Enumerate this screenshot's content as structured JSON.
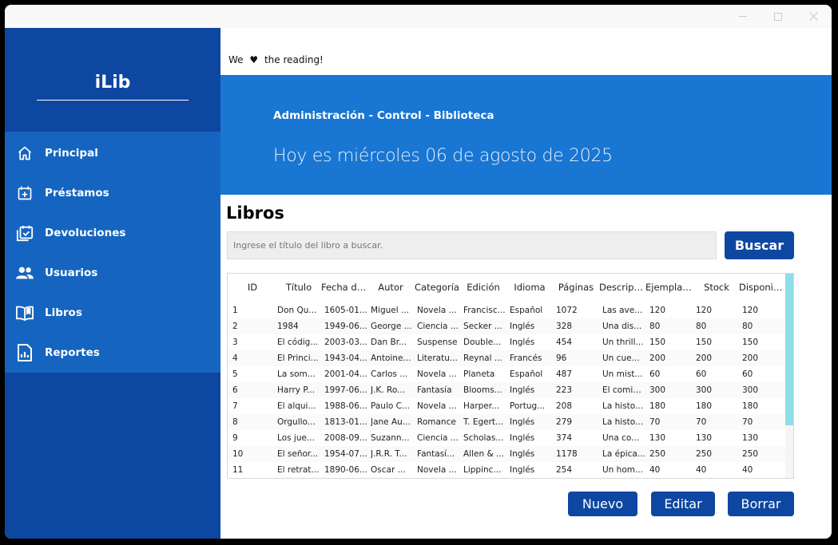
{
  "sidebar": {
    "logo": "iLib",
    "items": [
      {
        "label": "Principal",
        "icon": "home-icon"
      },
      {
        "label": "Préstamos",
        "icon": "calendar-plus-icon"
      },
      {
        "label": "Devoluciones",
        "icon": "calendar-check-icon"
      },
      {
        "label": "Usuarios",
        "icon": "users-icon"
      },
      {
        "label": "Libros",
        "icon": "book-open-icon"
      },
      {
        "label": "Reportes",
        "icon": "report-icon"
      }
    ]
  },
  "header": {
    "tagline_start": "We",
    "tagline_heart": "♥",
    "tagline_end": "the reading!",
    "subtitle": "Administración - Control - Biblioteca",
    "date_text": "Hoy es miércoles 06 de agosto de 2025"
  },
  "main": {
    "title": "Libros",
    "search_placeholder": "Ingrese el título del libro a buscar.",
    "search_button": "Buscar",
    "new_button": "Nuevo",
    "edit_button": "Editar",
    "delete_button": "Borrar"
  },
  "table": {
    "columns": [
      "ID",
      "Título",
      "Fecha de...",
      "Autor",
      "Categoría",
      "Edición",
      "Idioma",
      "Páginas",
      "Descripci...",
      "Ejemplares",
      "Stock",
      "Disponib..."
    ],
    "rows": [
      [
        "1",
        "Don Qu...",
        "1605-01...",
        "Miguel ...",
        "Novela ...",
        "Francisc...",
        "Español",
        "1072",
        "Las ave...",
        "120",
        "120",
        "120"
      ],
      [
        "2",
        "1984",
        "1949-06...",
        "George ...",
        "Ciencia ...",
        "Secker ...",
        "Inglés",
        "328",
        "Una dis...",
        "80",
        "80",
        "80"
      ],
      [
        "3",
        "El códig...",
        "2003-03...",
        "Dan Br...",
        "Suspense",
        "Double...",
        "Inglés",
        "454",
        "Un thrill...",
        "150",
        "150",
        "150"
      ],
      [
        "4",
        "El Princi...",
        "1943-04...",
        "Antoine...",
        "Literatu...",
        "Reynal ...",
        "Francés",
        "96",
        "Un cue...",
        "200",
        "200",
        "200"
      ],
      [
        "5",
        "La som...",
        "2001-04...",
        "Carlos ...",
        "Novela ...",
        "Planeta",
        "Español",
        "487",
        "Un mist...",
        "60",
        "60",
        "60"
      ],
      [
        "6",
        "Harry P...",
        "1997-06...",
        "J.K. Ro...",
        "Fantasía",
        "Blooms...",
        "Inglés",
        "223",
        "El comie...",
        "300",
        "300",
        "300"
      ],
      [
        "7",
        "El alqui...",
        "1988-06...",
        "Paulo C...",
        "Novela ...",
        "Harper...",
        "Portug...",
        "208",
        "La histo...",
        "180",
        "180",
        "180"
      ],
      [
        "8",
        "Orgullo...",
        "1813-01...",
        "Jane Au...",
        "Romance",
        "T. Egert...",
        "Inglés",
        "279",
        "La histo...",
        "70",
        "70",
        "70"
      ],
      [
        "9",
        "Los jue...",
        "2008-09...",
        "Suzann...",
        "Ciencia ...",
        "Scholas...",
        "Inglés",
        "374",
        "Una co...",
        "130",
        "130",
        "130"
      ],
      [
        "10",
        "El señor...",
        "1954-07...",
        "J.R.R. T...",
        "Fantasí...",
        "Allen & ...",
        "Inglés",
        "1178",
        "La épica...",
        "250",
        "250",
        "250"
      ],
      [
        "11",
        "El retrat...",
        "1890-06...",
        "Oscar ...",
        "Novela ...",
        "Lippinc...",
        "Inglés",
        "254",
        "Un hom...",
        "40",
        "40",
        "40"
      ]
    ]
  },
  "colors": {
    "sidebar_dark": "#0d47a1",
    "sidebar_nav": "#1565c0",
    "banner": "#1976d2",
    "button": "#0d47a1",
    "scroll_thumb": "#8fdfe8"
  }
}
